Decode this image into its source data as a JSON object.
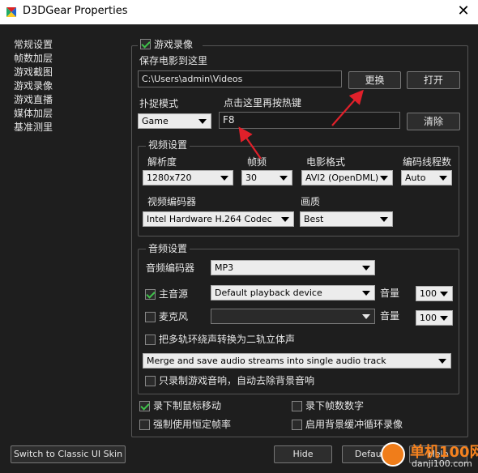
{
  "window": {
    "title": "D3DGear Properties",
    "close_glyph": "✕"
  },
  "sidebar": {
    "items": [
      {
        "label": "常规设置"
      },
      {
        "label": "帧数加层"
      },
      {
        "label": "游戏截图"
      },
      {
        "label": "游戏录像"
      },
      {
        "label": "游戏直播"
      },
      {
        "label": "媒体加层"
      },
      {
        "label": "基准测里"
      }
    ]
  },
  "recording": {
    "enable_label": "游戏录像",
    "enabled": true,
    "save_to_label": "保存电影到这里",
    "save_path": "C:\\Users\\admin\\Videos",
    "change_button": "更换",
    "open_button": "打开",
    "capture_mode_label": "扑捉模式",
    "capture_mode_value": "Game",
    "hotkey_label": "点击这里再按热键",
    "hotkey_value": "F8",
    "clear_button": "清除"
  },
  "video": {
    "group_title": "视频设置",
    "resolution_label": "解析度",
    "resolution_value": "1280x720",
    "fps_label": "帧频",
    "fps_value": "30",
    "format_label": "电影格式",
    "format_value": "AVI2 (OpenDML)",
    "threads_label": "编码线程数",
    "threads_value": "Auto",
    "encoder_label": "视频编码器",
    "encoder_value": "Intel Hardware H.264 Codec",
    "quality_label": "画质",
    "quality_value": "Best"
  },
  "audio": {
    "group_title": "音频设置",
    "encoder_label": "音频编码器",
    "encoder_value": "MP3",
    "main_source_label": "主音源",
    "main_source_checked": true,
    "main_source_device": "Default playback device",
    "main_volume_label": "音量",
    "main_volume_value": "100",
    "mic_label": "麦克风",
    "mic_checked": false,
    "mic_device": "",
    "mic_volume_label": "音量",
    "mic_volume_value": "100",
    "surround_label": "把多轨环绕声转换为二轨立体声",
    "surround_checked": false,
    "merge_value": "Merge and save audio streams into single audio track",
    "game_only_label": "只录制游戏音响，自动去除背景音响",
    "game_only_checked": false
  },
  "options": {
    "mouse_label": "录下制鼠标移动",
    "mouse_checked": true,
    "fps_overlay_label": "录下帧数数字",
    "fps_overlay_checked": false,
    "force_fps_label": "强制使用恒定帧率",
    "force_fps_checked": false,
    "bg_buffer_label": "启用背景缓冲循环录像",
    "bg_buffer_checked": false
  },
  "footer": {
    "classic_ui_button": "Switch to Classic UI Skin",
    "hide_button": "Hide",
    "default_button": "Default",
    "help_button": "Help"
  },
  "watermark": {
    "line1": "单机100网",
    "line2": "danji100.com"
  },
  "colors": {
    "background": "#1e1e1e",
    "check_green": "#3fc24a",
    "arrow_red": "#e0202a",
    "watermark_orange": "#f5821f"
  },
  "icons": {
    "app": "d3dgear-logo-icon",
    "close": "close-icon",
    "dropdown": "chevron-down-icon"
  }
}
